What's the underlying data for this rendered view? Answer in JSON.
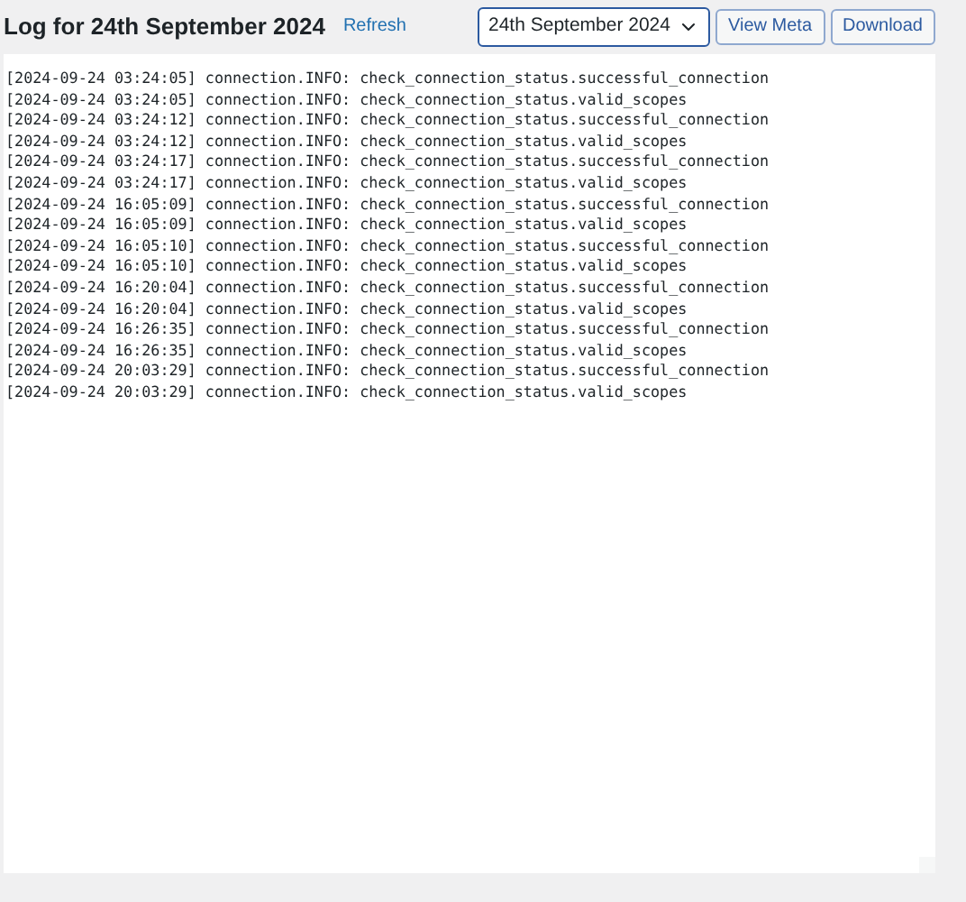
{
  "header": {
    "title": "Log for 24th September 2024",
    "refresh_link": "Refresh"
  },
  "date_select": {
    "value": "24th September 2024"
  },
  "buttons": [
    "View Meta",
    "Download"
  ],
  "log_lines": [
    "[2024-09-24 03:24:05] connection.INFO: check_connection_status.successful_connection",
    "[2024-09-24 03:24:05] connection.INFO: check_connection_status.valid_scopes",
    "[2024-09-24 03:24:12] connection.INFO: check_connection_status.successful_connection",
    "[2024-09-24 03:24:12] connection.INFO: check_connection_status.valid_scopes",
    "[2024-09-24 03:24:17] connection.INFO: check_connection_status.successful_connection",
    "[2024-09-24 03:24:17] connection.INFO: check_connection_status.valid_scopes",
    "[2024-09-24 16:05:09] connection.INFO: check_connection_status.successful_connection",
    "[2024-09-24 16:05:09] connection.INFO: check_connection_status.valid_scopes",
    "[2024-09-24 16:05:10] connection.INFO: check_connection_status.successful_connection",
    "[2024-09-24 16:05:10] connection.INFO: check_connection_status.valid_scopes",
    "[2024-09-24 16:20:04] connection.INFO: check_connection_status.successful_connection",
    "[2024-09-24 16:20:04] connection.INFO: check_connection_status.valid_scopes",
    "[2024-09-24 16:26:35] connection.INFO: check_connection_status.successful_connection",
    "[2024-09-24 16:26:35] connection.INFO: check_connection_status.valid_scopes",
    "[2024-09-24 20:03:29] connection.INFO: check_connection_status.successful_connection",
    "[2024-09-24 20:03:29] connection.INFO: check_connection_status.valid_scopes"
  ]
}
